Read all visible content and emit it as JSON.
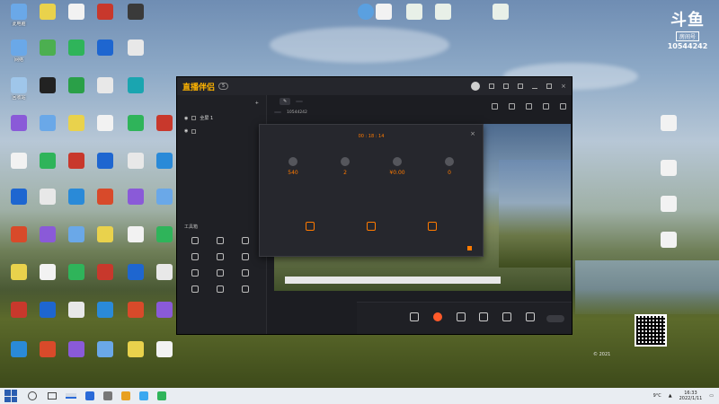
{
  "desktop": {
    "icons": [
      {
        "label": "此电脑",
        "color": "#6aa8e8"
      },
      {
        "label": "",
        "color": "#e9d24c"
      },
      {
        "label": "",
        "color": "#f2f2f2"
      },
      {
        "label": "",
        "color": "#c8382c"
      },
      {
        "label": "",
        "color": "#3a3a3a"
      },
      {
        "label": "网络",
        "color": "#6aa8e8"
      },
      {
        "label": "",
        "color": "#4caf50"
      },
      {
        "label": "",
        "color": "#2fb45a"
      },
      {
        "label": "",
        "color": "#1e66d0"
      },
      {
        "label": "",
        "color": "#e8e8e8"
      },
      {
        "label": "回收站",
        "color": "#9fc6ea"
      },
      {
        "label": "",
        "color": "#222"
      },
      {
        "label": "",
        "color": "#2aa048"
      },
      {
        "label": "",
        "color": "#e8e8e8"
      },
      {
        "label": "",
        "color": "#1aa5b0"
      }
    ],
    "top_files": [
      "",
      "",
      "",
      ""
    ],
    "right_files": [
      "",
      "",
      ""
    ]
  },
  "brand": {
    "mark": "斗鱼",
    "room_label": "房间号",
    "room_number": "10544242"
  },
  "app": {
    "title": "直播伴侣",
    "version": "5",
    "sidebar_tabs": [
      "",
      "",
      ""
    ],
    "scenes": [
      "全屏 1",
      ""
    ],
    "tools_title": "工具箱",
    "tools": [
      "",
      "",
      "",
      "",
      "",
      "",
      "",
      "",
      "",
      "",
      "",
      ""
    ],
    "footer_note": "",
    "room_name": "",
    "room_chip": "",
    "room_meta": "",
    "room_id": "10544242",
    "bottom_buttons": [
      {
        "label": "",
        "live": false
      },
      {
        "label": "",
        "live": true
      },
      {
        "label": "",
        "live": false
      },
      {
        "label": "",
        "live": false
      },
      {
        "label": "",
        "live": false
      },
      {
        "label": "",
        "live": false
      }
    ],
    "start_label": ""
  },
  "dialog": {
    "title": "",
    "duration": "00 : 18 : 14",
    "stats": [
      {
        "value": "540",
        "label": ""
      },
      {
        "value": "2",
        "label": ""
      },
      {
        "value": "¥0.00",
        "label": ""
      },
      {
        "value": "0",
        "label": ""
      }
    ],
    "tip": "",
    "tip_link": "",
    "actions": [
      "",
      "",
      ""
    ],
    "footer_label": ""
  },
  "copyright": "© 2021",
  "taskbar": {
    "app_label": "",
    "weather": "9°C",
    "time": "16:33",
    "date": "2022/1/11",
    "cpu": ""
  }
}
